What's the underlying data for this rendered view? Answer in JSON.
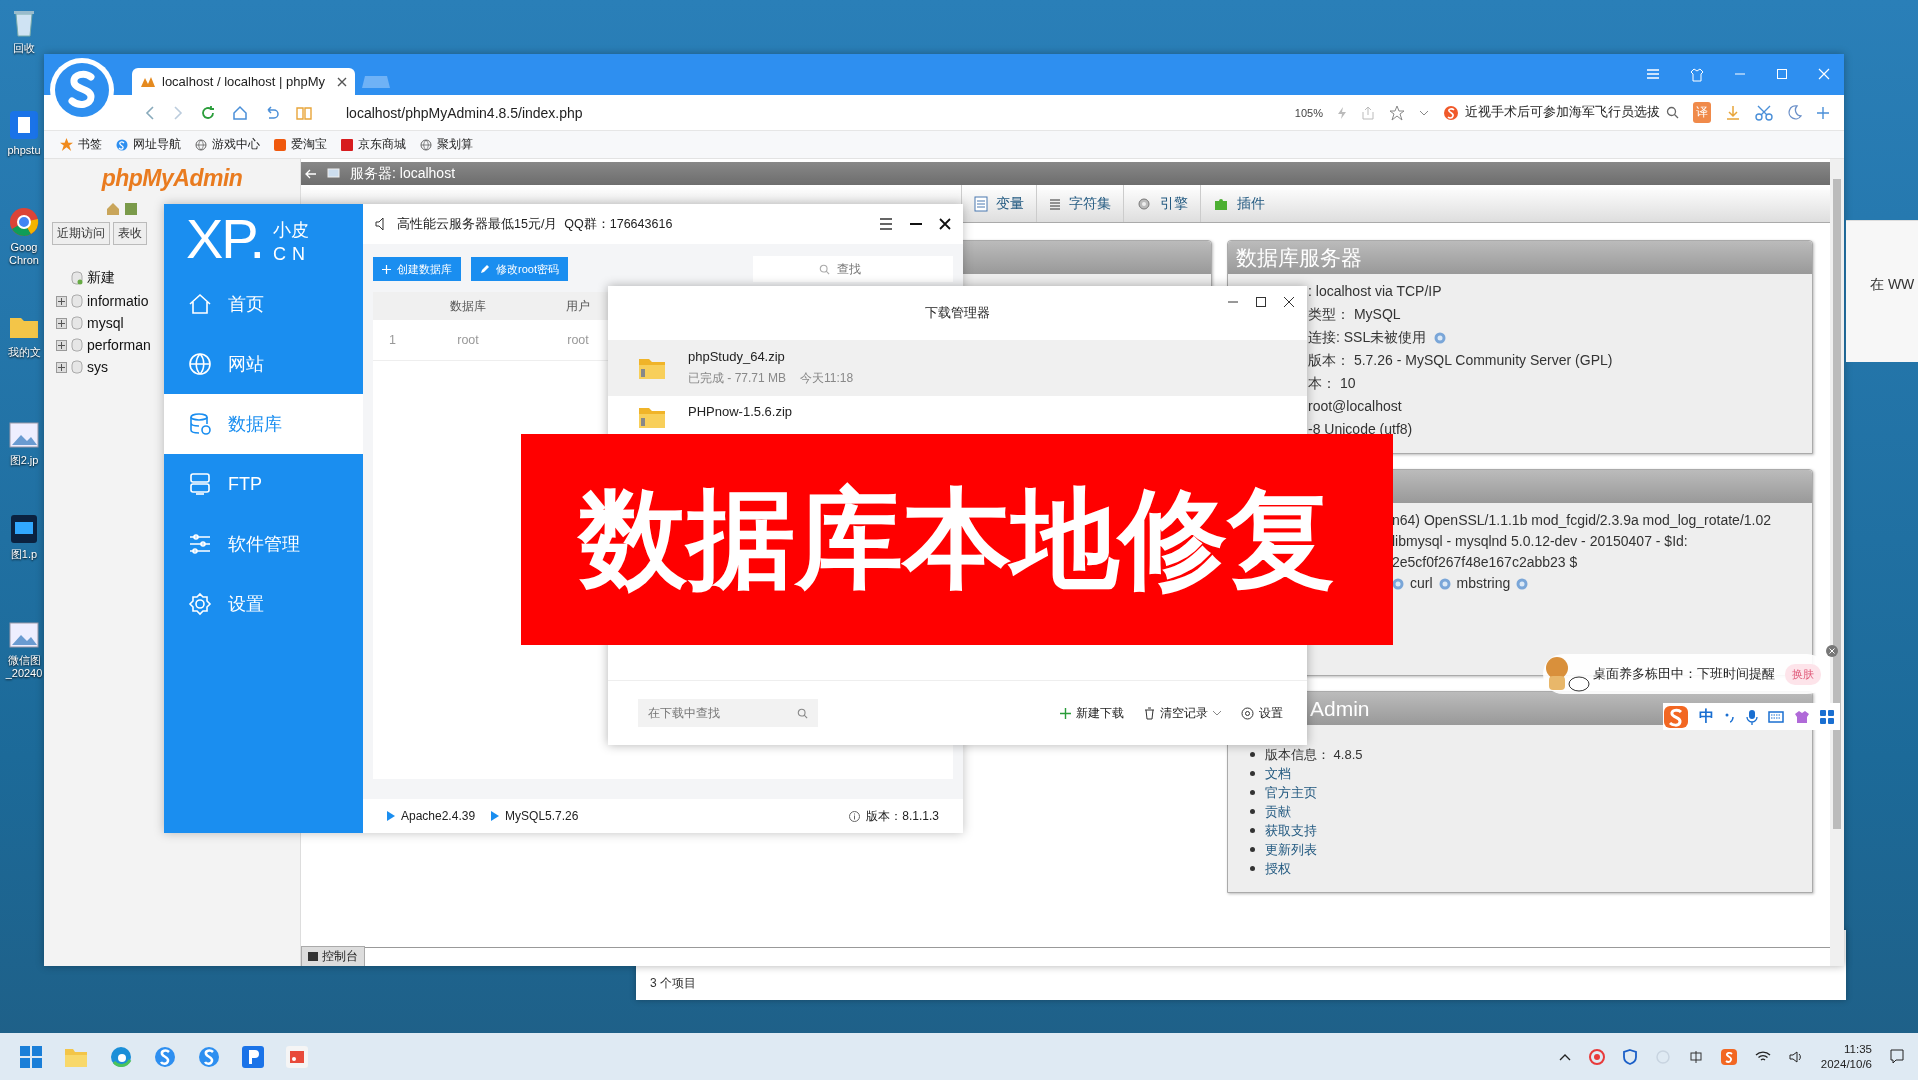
{
  "desktop_icons": [
    {
      "label": "回收",
      "kind": "bin"
    },
    {
      "label": "phpstu",
      "kind": "app"
    },
    {
      "label": "Goog Chron",
      "kind": "chrome"
    },
    {
      "label": "我的文",
      "kind": "folder"
    },
    {
      "label": "图2.jp",
      "kind": "image"
    },
    {
      "label": "图1.p",
      "kind": "psd"
    },
    {
      "label": "微信图 _20240",
      "kind": "image"
    }
  ],
  "browser": {
    "tab_title": "localhost / localhost | phpMy",
    "address": "localhost/phpMyAdmin4.8.5/index.php",
    "zoom": "105%",
    "news": "近视手术后可参加海军飞行员选拔",
    "translate": "译",
    "bookmarks": [
      {
        "label": "书签",
        "kind": "star"
      },
      {
        "label": "网址导航",
        "kind": "sogou"
      },
      {
        "label": "游戏中心",
        "kind": "globe"
      },
      {
        "label": "爱淘宝",
        "kind": "taobao"
      },
      {
        "label": "京东商城",
        "kind": "jd"
      },
      {
        "label": "聚划算",
        "kind": "globe"
      }
    ]
  },
  "pma": {
    "logo": "phpMyAdmin",
    "nav_tabs": [
      "近期访问",
      "表收"
    ],
    "tree": [
      {
        "label": "新建",
        "kind": "new"
      },
      {
        "label": "informatio",
        "kind": "db"
      },
      {
        "label": "mysql",
        "kind": "db"
      },
      {
        "label": "performan",
        "kind": "db"
      },
      {
        "label": "sys",
        "kind": "db"
      }
    ],
    "server_title": "服务器: localhost",
    "tabs": [
      "变量",
      "字符集",
      "引擎",
      "插件"
    ],
    "db_server": {
      "title": "数据库服务器",
      "rows": [
        {
          "text": ": localhost via TCP/IP",
          "help": false
        },
        {
          "text": "类型：  MySQL",
          "help": false
        },
        {
          "text": "连接: SSL未被使用",
          "help": true
        },
        {
          "text": "版本：  5.7.26 - MySQL Community Server (GPL)",
          "help": false
        },
        {
          "text": "本：  10",
          "help": false
        },
        {
          "text": "root@localhost",
          "help": false
        },
        {
          "text": "-8 Unicode (utf8)",
          "help": false
        }
      ]
    },
    "web_server": {
      "rows": [
        "n64) OpenSSL/1.1.1b mod_fcgid/2.3.9a mod_log_rotate/1.02",
        "libmysql - mysqlnd 5.0.12-dev - 20150407 - $Id:",
        "2e5cf0f267f48e167c2abb23 $"
      ],
      "extensions": [
        "curl",
        "mbstring"
      ]
    },
    "about": {
      "title": "Admin",
      "items": [
        "版本信息：  4.8.5",
        "文档",
        "官方主页",
        "贡献",
        "获取支持",
        "更新列表",
        "授权"
      ]
    },
    "console": "控制台"
  },
  "xp": {
    "logo_main": "XP.",
    "logo_top": "小皮",
    "logo_bottom": "CN",
    "notice": "高性能云服务器最低15元/月  QQ群：176643616",
    "menu": [
      {
        "label": "首页",
        "kind": "home",
        "selected": false
      },
      {
        "label": "网站",
        "kind": "globe",
        "selected": false
      },
      {
        "label": "数据库",
        "kind": "database",
        "selected": true
      },
      {
        "label": "FTP",
        "kind": "server",
        "selected": false
      },
      {
        "label": "软件管理",
        "kind": "sliders",
        "selected": false
      },
      {
        "label": "设置",
        "kind": "gear",
        "selected": false
      }
    ],
    "actions": [
      {
        "label": "创建数据库",
        "kind": "plus"
      },
      {
        "label": "修改root密码",
        "kind": "pencil"
      }
    ],
    "search_placeholder": "查找",
    "columns": [
      "数据库",
      "用户"
    ],
    "rows": [
      {
        "index": "1",
        "database": "root",
        "user": "root"
      }
    ],
    "services": [
      "Apache2.4.39",
      "MySQL5.7.26"
    ],
    "version": "版本：8.1.1.3"
  },
  "downloads": {
    "title": "下载管理器",
    "items": [
      {
        "name": "phpStudy_64.zip",
        "status": "已完成 - 77.71 MB",
        "time": "今天11:18",
        "selected": true
      },
      {
        "name": "PHPnow-1.5.6.zip",
        "selected": false
      }
    ],
    "search_placeholder": "在下载中查找",
    "actions": [
      {
        "label": "新建下载",
        "kind": "plus"
      },
      {
        "label": "清空记录",
        "kind": "trash"
      },
      {
        "label": "设置",
        "kind": "gear"
      }
    ]
  },
  "banner": "数据库本地修复",
  "side_window": {
    "text": "在 WW"
  },
  "explorer_status": "3 个项目",
  "pet": {
    "message": "桌面养多栋田中：下班时间提醒",
    "skin_button": "换肤"
  },
  "ime": {
    "mode": "中"
  },
  "taskbar": {
    "time": "11:35",
    "date": "2024/10/6"
  }
}
